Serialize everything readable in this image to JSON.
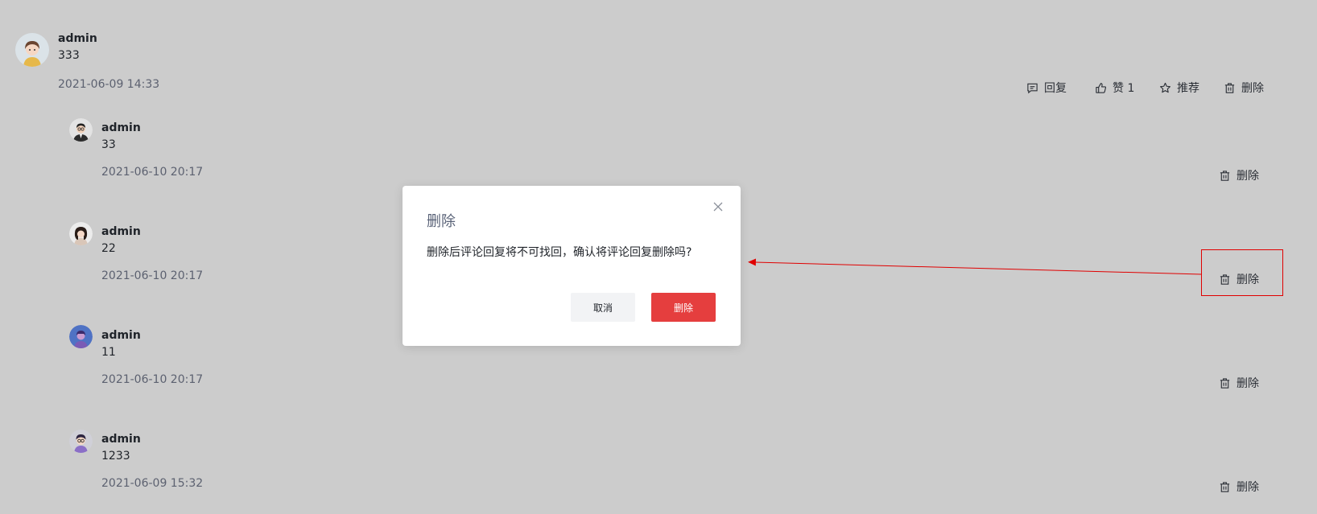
{
  "comment": {
    "username": "admin",
    "content": "333",
    "time": "2021-06-09 14:33",
    "actions": {
      "reply_label": "回复",
      "like_label": "赞 1",
      "recommend_label": "推荐",
      "delete_label": "删除"
    }
  },
  "replies": [
    {
      "username": "admin",
      "content": "33",
      "time": "2021-06-10 20:17",
      "delete_label": "删除"
    },
    {
      "username": "admin",
      "content": "22",
      "time": "2021-06-10 20:17",
      "delete_label": "删除"
    },
    {
      "username": "admin",
      "content": "11",
      "time": "2021-06-10 20:17",
      "delete_label": "删除"
    },
    {
      "username": "admin",
      "content": "1233",
      "time": "2021-06-09 15:32",
      "delete_label": "删除"
    }
  ],
  "dialog": {
    "title": "删除",
    "message": "删除后评论回复将不可找回，确认将评论回复删除吗?",
    "cancel_label": "取消",
    "confirm_label": "删除"
  },
  "icons": {
    "reply": "comment-icon",
    "like": "thumbs-up-icon",
    "recommend": "star-icon",
    "delete": "trash-icon",
    "close": "close-icon"
  },
  "colors": {
    "overlay_background": "#cccccc",
    "danger": "#e53e3e",
    "annotation": "#e00000"
  }
}
